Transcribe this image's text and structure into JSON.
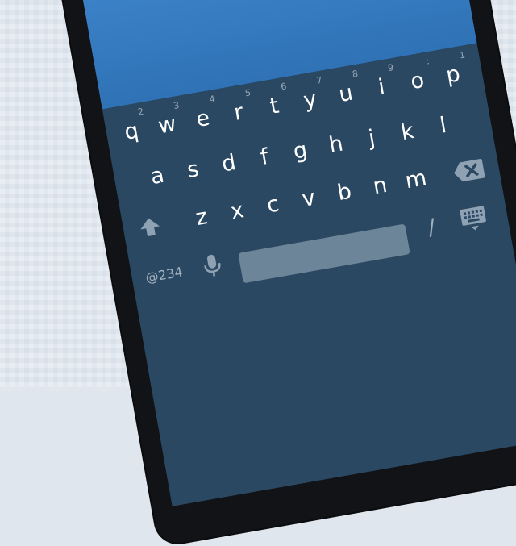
{
  "keyboard": {
    "rows": {
      "r1": [
        {
          "key": "q",
          "hint": "2"
        },
        {
          "key": "w",
          "hint": "3"
        },
        {
          "key": "e",
          "hint": "4"
        },
        {
          "key": "r",
          "hint": "5"
        },
        {
          "key": "t",
          "hint": "6"
        },
        {
          "key": "y",
          "hint": "7"
        },
        {
          "key": "u",
          "hint": "8"
        },
        {
          "key": "i",
          "hint": "9"
        },
        {
          "key": "o",
          "hint": ":"
        },
        {
          "key": "p",
          "hint": "1"
        }
      ],
      "r2": [
        "a",
        "s",
        "d",
        "f",
        "g",
        "h",
        "j",
        "k",
        "l"
      ],
      "r3": [
        "z",
        "x",
        "c",
        "v",
        "b",
        "n",
        "m"
      ],
      "bottom": {
        "symbols": "@234",
        "slash": "/"
      }
    },
    "icons": {
      "shift": "shift-arrow-icon",
      "delete": "backspace-icon",
      "mic": "microphone-icon",
      "hide": "keyboard-hide-icon"
    },
    "colors": {
      "keyboard_bg": "#2b4862",
      "key_text": "#ffffff",
      "hint_text": "#99a8b6",
      "spacebar": "#6d8599",
      "app_bg": "#3f86cd"
    }
  }
}
